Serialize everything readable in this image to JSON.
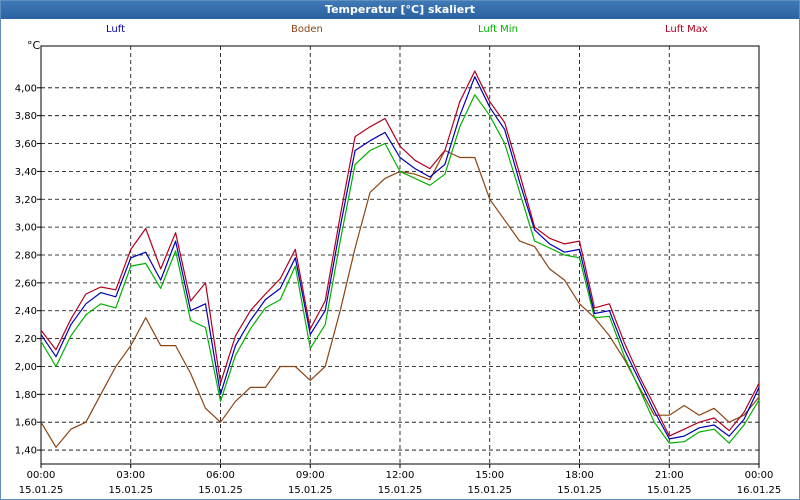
{
  "window": {
    "title": "Temperatur [°C] skaliert"
  },
  "chart_data": {
    "type": "line",
    "title": "Temperatur [°C] skaliert",
    "y_unit": "°C",
    "ylim": [
      1.3,
      4.3
    ],
    "xlim": [
      0,
      24
    ],
    "grid": true,
    "yticks": [
      "1,40",
      "1,60",
      "1,80",
      "2,00",
      "2,20",
      "2,40",
      "2,60",
      "2,80",
      "3,00",
      "3,20",
      "3,40",
      "3,60",
      "3,80",
      "4,00"
    ],
    "xticks": [
      {
        "time": "00:00",
        "date": "15.01.25"
      },
      {
        "time": "03:00",
        "date": "15.01.25"
      },
      {
        "time": "06:00",
        "date": "15.01.25"
      },
      {
        "time": "09:00",
        "date": "15.01.25"
      },
      {
        "time": "12:00",
        "date": "15.01.25"
      },
      {
        "time": "15:00",
        "date": "15.01.25"
      },
      {
        "time": "18:00",
        "date": "15.01.25"
      },
      {
        "time": "21:00",
        "date": "15.01.25"
      },
      {
        "time": "00:00",
        "date": "16.01.25"
      }
    ],
    "x": [
      0,
      0.5,
      1,
      1.5,
      2,
      2.5,
      3,
      3.5,
      4,
      4.5,
      5,
      5.5,
      6,
      6.5,
      7,
      7.5,
      8,
      8.5,
      9,
      9.5,
      10,
      10.5,
      11,
      11.5,
      12,
      12.5,
      13,
      13.5,
      14,
      14.5,
      15,
      15.5,
      16,
      16.5,
      17,
      17.5,
      18,
      18.5,
      19,
      19.5,
      20,
      20.5,
      21,
      21.5,
      22,
      22.5,
      23,
      23.5,
      24
    ],
    "series": [
      {
        "name": "Luft",
        "color": "#0000b0",
        "values": [
          2.23,
          2.07,
          2.3,
          2.45,
          2.53,
          2.5,
          2.78,
          2.82,
          2.62,
          2.9,
          2.4,
          2.45,
          1.8,
          2.15,
          2.33,
          2.48,
          2.56,
          2.78,
          2.23,
          2.4,
          3.0,
          3.55,
          3.62,
          3.68,
          3.5,
          3.42,
          3.36,
          3.45,
          3.8,
          4.08,
          3.86,
          3.7,
          3.32,
          2.98,
          2.88,
          2.82,
          2.84,
          2.38,
          2.4,
          2.12,
          1.9,
          1.68,
          1.48,
          1.5,
          1.56,
          1.58,
          1.5,
          1.62,
          1.85
        ]
      },
      {
        "name": "Boden",
        "color": "#8b4513",
        "values": [
          1.6,
          1.42,
          1.55,
          1.6,
          1.8,
          2.0,
          2.15,
          2.35,
          2.15,
          2.15,
          1.95,
          1.7,
          1.6,
          1.75,
          1.85,
          1.85,
          2.0,
          2.0,
          1.9,
          2.0,
          2.4,
          2.85,
          3.25,
          3.35,
          3.4,
          3.38,
          3.34,
          3.55,
          3.5,
          3.5,
          3.2,
          3.05,
          2.9,
          2.86,
          2.7,
          2.62,
          2.45,
          2.35,
          2.22,
          2.05,
          1.85,
          1.65,
          1.65,
          1.72,
          1.65,
          1.7,
          1.6,
          1.65,
          1.78
        ]
      },
      {
        "name": "Luft Min",
        "color": "#00b000",
        "values": [
          2.18,
          2.0,
          2.22,
          2.37,
          2.45,
          2.42,
          2.72,
          2.74,
          2.56,
          2.83,
          2.33,
          2.28,
          1.75,
          2.08,
          2.27,
          2.42,
          2.48,
          2.72,
          2.13,
          2.3,
          2.9,
          3.45,
          3.55,
          3.6,
          3.4,
          3.35,
          3.3,
          3.38,
          3.72,
          3.95,
          3.8,
          3.6,
          3.25,
          2.9,
          2.85,
          2.8,
          2.78,
          2.35,
          2.36,
          2.07,
          1.84,
          1.6,
          1.45,
          1.46,
          1.53,
          1.55,
          1.45,
          1.58,
          1.76
        ]
      },
      {
        "name": "Luft Max",
        "color": "#b00020",
        "values": [
          2.26,
          2.12,
          2.34,
          2.52,
          2.57,
          2.55,
          2.84,
          2.99,
          2.7,
          2.96,
          2.47,
          2.6,
          1.88,
          2.22,
          2.4,
          2.52,
          2.63,
          2.84,
          2.27,
          2.47,
          3.08,
          3.65,
          3.72,
          3.78,
          3.58,
          3.48,
          3.42,
          3.55,
          3.9,
          4.12,
          3.9,
          3.75,
          3.38,
          3.0,
          2.92,
          2.88,
          2.9,
          2.42,
          2.45,
          2.17,
          1.93,
          1.72,
          1.5,
          1.55,
          1.6,
          1.63,
          1.54,
          1.67,
          1.88
        ]
      }
    ]
  }
}
